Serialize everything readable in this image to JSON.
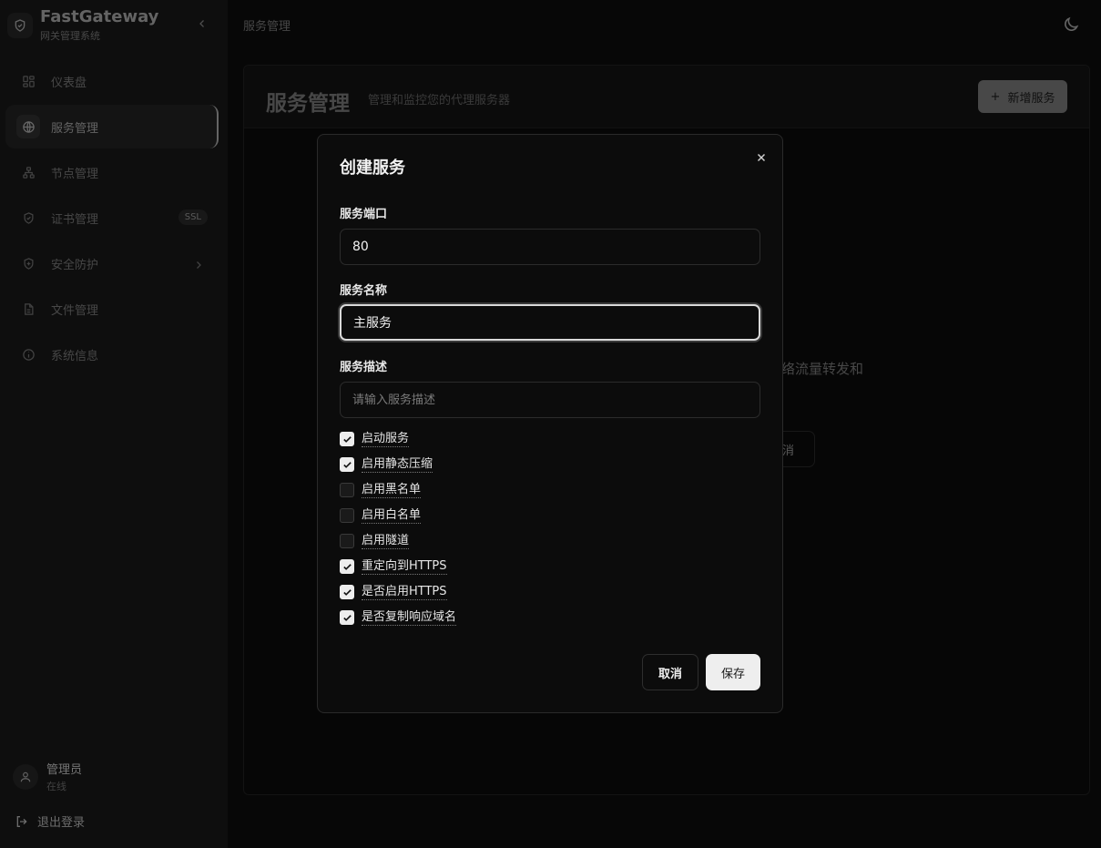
{
  "brand": {
    "title": "FastGateway",
    "subtitle": "网关管理系统"
  },
  "sidebar": {
    "items": [
      {
        "label": "仪表盘",
        "icon": "dashboard-icon"
      },
      {
        "label": "服务管理",
        "icon": "globe-icon",
        "active": true
      },
      {
        "label": "节点管理",
        "icon": "sitemap-icon"
      },
      {
        "label": "证书管理",
        "icon": "shield-check-icon",
        "badge": "SSL"
      },
      {
        "label": "安全防护",
        "icon": "shield-plus-icon",
        "has_submenu": true
      },
      {
        "label": "文件管理",
        "icon": "file-icon"
      },
      {
        "label": "系统信息",
        "icon": "info-icon"
      }
    ]
  },
  "user": {
    "name": "管理员",
    "status": "在线"
  },
  "logout_label": "退出登录",
  "breadcrumb": "服务管理",
  "page": {
    "title": "服务管理",
    "description": "管理和监控您的代理服务器",
    "add_button": "新增服务",
    "background_text": "络流量转发和",
    "background_button": "消"
  },
  "modal": {
    "title": "创建服务",
    "port_label": "服务端口",
    "port_value": "80",
    "name_label": "服务名称",
    "name_value": "主服务",
    "desc_label": "服务描述",
    "desc_placeholder": "请输入服务描述",
    "options": [
      {
        "label": "启动服务",
        "checked": true
      },
      {
        "label": "启用静态压缩",
        "checked": true
      },
      {
        "label": "启用黑名单",
        "checked": false
      },
      {
        "label": "启用白名单",
        "checked": false
      },
      {
        "label": "启用隧道",
        "checked": false
      },
      {
        "label": "重定向到HTTPS",
        "checked": true
      },
      {
        "label": "是否启用HTTPS",
        "checked": true
      },
      {
        "label": "是否复制响应域名",
        "checked": true
      }
    ],
    "cancel_label": "取消",
    "save_label": "保存"
  }
}
